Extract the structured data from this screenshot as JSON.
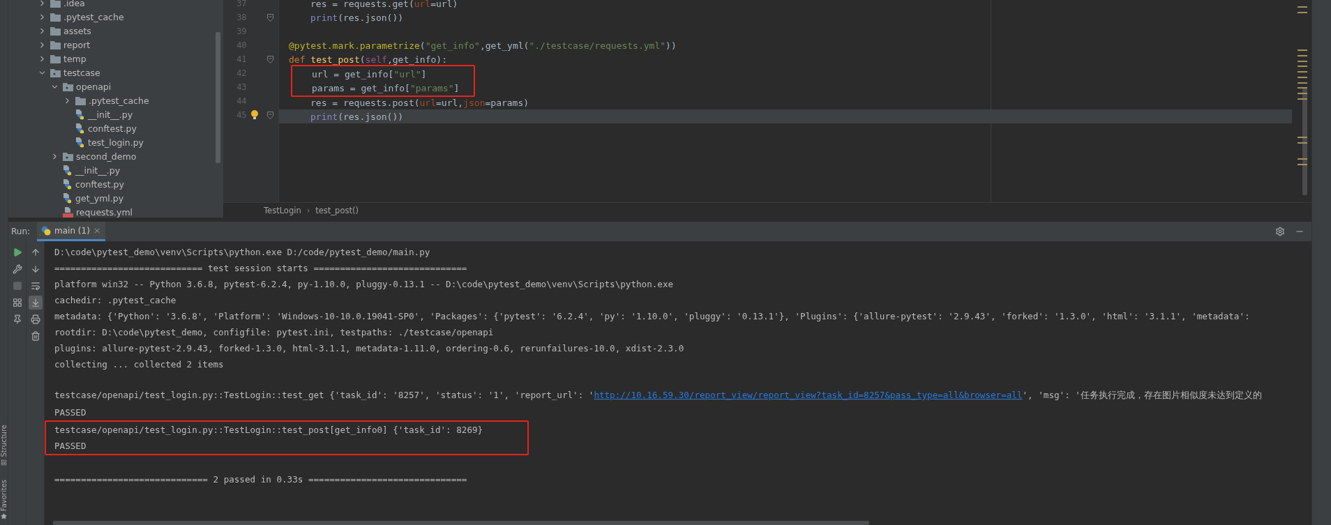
{
  "project_tree": [
    {
      "kind": "folder",
      "label": ".idea",
      "expanded": false
    },
    {
      "kind": "folder",
      "label": ".pytest_cache",
      "expanded": false
    },
    {
      "kind": "folder",
      "label": "assets",
      "expanded": false
    },
    {
      "kind": "folder",
      "label": "report",
      "expanded": false
    },
    {
      "kind": "folder",
      "label": "temp",
      "expanded": false
    },
    {
      "kind": "package",
      "label": "testcase",
      "expanded": true,
      "children": [
        {
          "kind": "package",
          "label": "openapi",
          "expanded": true,
          "children": [
            {
              "kind": "folder",
              "label": ".pytest_cache",
              "expanded": false
            },
            {
              "kind": "python",
              "label": "__init__.py"
            },
            {
              "kind": "python",
              "label": "conftest.py"
            },
            {
              "kind": "python",
              "label": "test_login.py"
            }
          ]
        },
        {
          "kind": "package",
          "label": "second_demo",
          "expanded": false
        },
        {
          "kind": "python",
          "label": "__init__.py"
        },
        {
          "kind": "python",
          "label": "conftest.py"
        },
        {
          "kind": "python",
          "label": "get_yml.py"
        },
        {
          "kind": "yml",
          "label": "requests.yml"
        }
      ]
    }
  ],
  "editor": {
    "lines": [
      {
        "number": "37",
        "kind": "body",
        "annotated": false,
        "current": false,
        "fold": false,
        "bulb": false,
        "tokens": [
          {
            "kind": "plain",
            "text": "res = requests.get("
          },
          {
            "kind": "param",
            "text": "url"
          },
          {
            "kind": "plain",
            "text": "=url)"
          }
        ]
      },
      {
        "number": "38",
        "kind": "body",
        "annotated": false,
        "current": false,
        "fold": true,
        "bulb": false,
        "tokens": [
          {
            "kind": "builtin",
            "text": "print"
          },
          {
            "kind": "plain",
            "text": "(res.json())"
          }
        ]
      },
      {
        "number": "39",
        "kind": "body",
        "annotated": false,
        "current": false,
        "fold": false,
        "bulb": false
      },
      {
        "number": "40",
        "kind": "header",
        "annotated": false,
        "current": false,
        "fold": false,
        "bulb": false,
        "tokens": [
          {
            "kind": "decorator",
            "text": "@pytest.mark.parametrize"
          },
          {
            "kind": "plain",
            "text": "("
          },
          {
            "kind": "string",
            "text": "\"get_info\""
          },
          {
            "kind": "plain",
            "text": ",get_yml("
          },
          {
            "kind": "string",
            "text": "\"./testcase/requests.yml\""
          },
          {
            "kind": "plain",
            "text": "))"
          }
        ]
      },
      {
        "number": "41",
        "kind": "header",
        "annotated": false,
        "current": false,
        "fold": true,
        "bulb": false,
        "tokens": [
          {
            "kind": "keyword",
            "text": "def "
          },
          {
            "kind": "function",
            "text": "test_post"
          },
          {
            "kind": "plain",
            "text": "("
          },
          {
            "kind": "self",
            "text": "self"
          },
          {
            "kind": "plain",
            "text": ",get_info):"
          }
        ]
      },
      {
        "number": "42",
        "kind": "body",
        "annotated": true,
        "current": false,
        "fold": false,
        "bulb": false,
        "tokens": [
          {
            "kind": "plain",
            "text": "url = get_info["
          },
          {
            "kind": "string",
            "text": "\"url\""
          },
          {
            "kind": "plain",
            "text": "]"
          }
        ]
      },
      {
        "number": "43",
        "kind": "body",
        "annotated": true,
        "current": false,
        "fold": false,
        "bulb": false,
        "tokens": [
          {
            "kind": "plain",
            "text": "params = get_info["
          },
          {
            "kind": "string",
            "text": "\"params\""
          },
          {
            "kind": "plain",
            "text": "]"
          }
        ]
      },
      {
        "number": "44",
        "kind": "body",
        "annotated": false,
        "current": false,
        "fold": false,
        "bulb": false,
        "tokens": [
          {
            "kind": "plain",
            "text": "res = requests.post("
          },
          {
            "kind": "param",
            "text": "url"
          },
          {
            "kind": "plain",
            "text": "=url,"
          },
          {
            "kind": "param",
            "text": "json"
          },
          {
            "kind": "plain",
            "text": "=params)"
          }
        ]
      },
      {
        "number": "45",
        "kind": "body",
        "annotated": false,
        "current": true,
        "fold": true,
        "bulb": true,
        "tokens": [
          {
            "kind": "builtin",
            "text": "print"
          },
          {
            "kind": "plain",
            "text": "(res.json())"
          }
        ]
      }
    ],
    "breadcrumbs": [
      "TestLogin",
      "test_post()"
    ],
    "breadcrumb_separator": "›"
  },
  "run_panel": {
    "label": "Run:",
    "tab": {
      "title": "main (1)",
      "close": "×",
      "selected": true
    },
    "left_tools": [
      {
        "kind": "rerun",
        "disabled": false
      },
      {
        "kind": "settings",
        "disabled": false
      },
      {
        "kind": "stop",
        "disabled": true
      },
      {
        "kind": "layout",
        "disabled": false
      },
      {
        "kind": "pin",
        "disabled": false
      }
    ],
    "right_tools": [
      {
        "kind": "up",
        "selected": false
      },
      {
        "kind": "down",
        "selected": false
      },
      {
        "kind": "wrap",
        "selected": false
      },
      {
        "kind": "scroll_end",
        "selected": true
      },
      {
        "kind": "print",
        "selected": false
      },
      {
        "kind": "trash",
        "selected": false
      }
    ],
    "console": [
      {
        "annotated": false,
        "after_blank": false,
        "segments": [
          {
            "kind": "text",
            "text": "D:\\code\\pytest_demo\\venv\\Scripts\\python.exe D:/code/pytest_demo/main.py"
          }
        ]
      },
      {
        "annotated": false,
        "after_blank": false,
        "segments": [
          {
            "kind": "text",
            "text": "============================ test session starts ============================="
          }
        ]
      },
      {
        "annotated": false,
        "after_blank": false,
        "segments": [
          {
            "kind": "text",
            "text": "platform win32 -- Python 3.6.8, pytest-6.2.4, py-1.10.0, pluggy-0.13.1 -- D:\\code\\pytest_demo\\venv\\Scripts\\python.exe"
          }
        ]
      },
      {
        "annotated": false,
        "after_blank": false,
        "segments": [
          {
            "kind": "text",
            "text": "cachedir: .pytest_cache"
          }
        ]
      },
      {
        "annotated": false,
        "after_blank": false,
        "segments": [
          {
            "kind": "text",
            "text": "metadata: {'Python': '3.6.8', 'Platform': 'Windows-10-10.0.19041-SP0', 'Packages': {'pytest': '6.2.4', 'py': '1.10.0', 'pluggy': '0.13.1'}, 'Plugins': {'allure-pytest': '2.9.43', 'forked': '1.3.0', 'html': '3.1.1', 'metadata':"
          }
        ]
      },
      {
        "annotated": false,
        "after_blank": false,
        "segments": [
          {
            "kind": "text",
            "text": "rootdir: D:\\code\\pytest_demo, configfile: pytest.ini, testpaths: ./testcase/openapi"
          }
        ]
      },
      {
        "annotated": false,
        "after_blank": false,
        "segments": [
          {
            "kind": "text",
            "text": "plugins: allure-pytest-2.9.43, forked-1.3.0, html-3.1.1, metadata-1.11.0, ordering-0.6, rerunfailures-10.0, xdist-2.3.0"
          }
        ]
      },
      {
        "annotated": false,
        "after_blank": false,
        "segments": [
          {
            "kind": "text",
            "text": "collecting ... collected 2 items"
          }
        ]
      },
      {
        "annotated": false,
        "after_blank": true,
        "segments": [
          {
            "kind": "text",
            "text": "testcase/openapi/test_login.py::TestLogin::test_get {'task_id': '8257', 'status': '1', 'report_url': '"
          },
          {
            "kind": "link",
            "text": "http://10.16.59.30/report_view/report_view?task_id=8257&pass_type=all&browser=all"
          },
          {
            "kind": "text",
            "text": "', 'msg': '任务执行完成，存在图片相似度未达到定义的"
          }
        ]
      },
      {
        "annotated": false,
        "after_blank": false,
        "segments": [
          {
            "kind": "text",
            "text": "PASSED"
          }
        ]
      },
      {
        "annotated": true,
        "after_blank": false,
        "segments": [
          {
            "kind": "text",
            "text": "testcase/openapi/test_login.py::TestLogin::test_post[get_info0] {'task_id': 8269}"
          }
        ]
      },
      {
        "annotated": true,
        "after_blank": false,
        "segments": [
          {
            "kind": "text",
            "text": "PASSED"
          }
        ]
      },
      {
        "annotated": false,
        "after_blank": true,
        "segments": [
          {
            "kind": "text",
            "text": "============================= 2 passed in 0.33s =============================="
          }
        ]
      }
    ]
  },
  "side_tabs": [
    "Structure",
    "Favorites"
  ]
}
